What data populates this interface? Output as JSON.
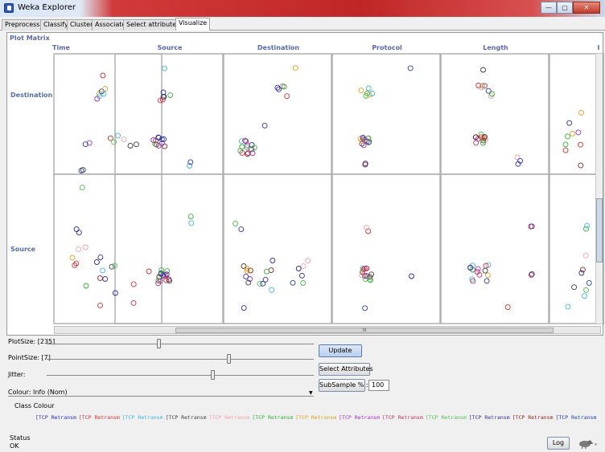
{
  "window": {
    "title": "Weka Explorer",
    "controls": [
      "—",
      "▢",
      "✕"
    ]
  },
  "tabs": [
    {
      "label": "Preprocess",
      "active": false
    },
    {
      "label": "Classify",
      "active": false
    },
    {
      "label": "Cluster",
      "active": false
    },
    {
      "label": "Associate",
      "active": false
    },
    {
      "label": "Select attributes",
      "active": false
    },
    {
      "label": "Visualize",
      "active": true
    }
  ],
  "plot_matrix": {
    "label": "Plot Matrix",
    "columns": [
      "Time",
      "Source",
      "Destination",
      "Protocol",
      "Length",
      "I"
    ],
    "rows": [
      "Destination",
      "Source"
    ],
    "hscroll_label": "III"
  },
  "controls": {
    "plot_size_label": "PlotSize: [235]",
    "plot_size_value": 0.42,
    "point_size_label": "PointSize: [7]",
    "point_size_value": 0.68,
    "jitter_label": "Jitter:",
    "jitter_value": 0.62,
    "colour_label": "Colour: Info (Nom)",
    "update_button": "Update",
    "select_attributes_button": "Select Attributes",
    "subsample_label": "SubSample % :",
    "subsample_value": "100"
  },
  "class_colour": {
    "label": "Class Colour",
    "legend": [
      {
        "text": "[TCP Retransm",
        "color": "#2b2bb8"
      },
      {
        "text": "[TCP Retransm",
        "color": "#d03030"
      },
      {
        "text": "[TCP Retransm",
        "color": "#40b8d8"
      },
      {
        "text": "[TCP Retransm",
        "color": "#404040"
      },
      {
        "text": "[TCP Retransm",
        "color": "#f0a0b0"
      },
      {
        "text": "[TCP Retransm",
        "color": "#30b030"
      },
      {
        "text": "[TCP Retransm",
        "color": "#e0a020"
      },
      {
        "text": "[TCP Retransm",
        "color": "#a030c0"
      },
      {
        "text": "[TCP Retransm",
        "color": "#c03060"
      },
      {
        "text": "[TCP Retransm",
        "color": "#50c050"
      },
      {
        "text": "[TCP Retransm",
        "color": "#303090"
      },
      {
        "text": "[TCP Retransm",
        "color": "#902020"
      },
      {
        "text": "[TCP Retransm",
        "color": "#2040a0"
      }
    ]
  },
  "status": {
    "label": "Status",
    "value": "OK",
    "log_button": "Log",
    "bird_icon": "weka-bird-icon",
    "bird_count": "x 0"
  }
}
